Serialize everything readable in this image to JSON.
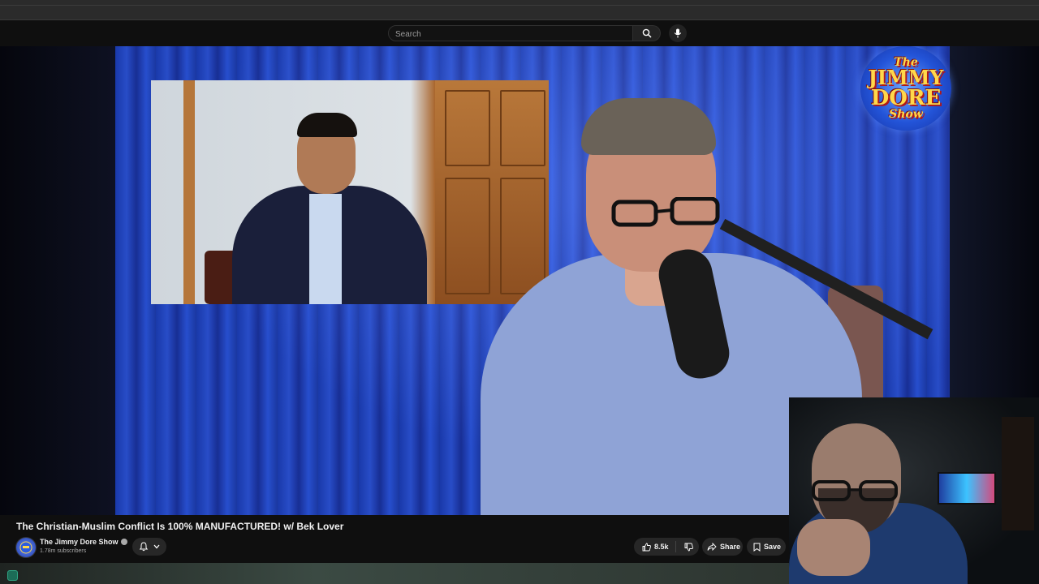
{
  "search": {
    "placeholder": "Search"
  },
  "icons": {
    "search": "search-icon",
    "mic": "mic-icon",
    "bell": "bell-icon",
    "like": "thumbs-up-icon",
    "dislike": "thumbs-down-icon",
    "share": "share-icon",
    "save": "bookmark-icon"
  },
  "logo": {
    "line1": "The",
    "line2": "JIMMY",
    "line3": "DORE",
    "line4": "Show"
  },
  "video": {
    "title": "The Christian-Muslim Conflict Is 100% MANUFACTURED! w/ Bek Lover",
    "channel": "The Jimmy Dore Show",
    "subscribers": "1.78m subscribers",
    "likes": "8.5k",
    "share_label": "Share",
    "save_label": "Save"
  },
  "colors": {
    "background": "#0f0f0f",
    "pill": "#272727",
    "curtain_blue": "#2c55d9",
    "logo_gold": "#ffd84a"
  }
}
